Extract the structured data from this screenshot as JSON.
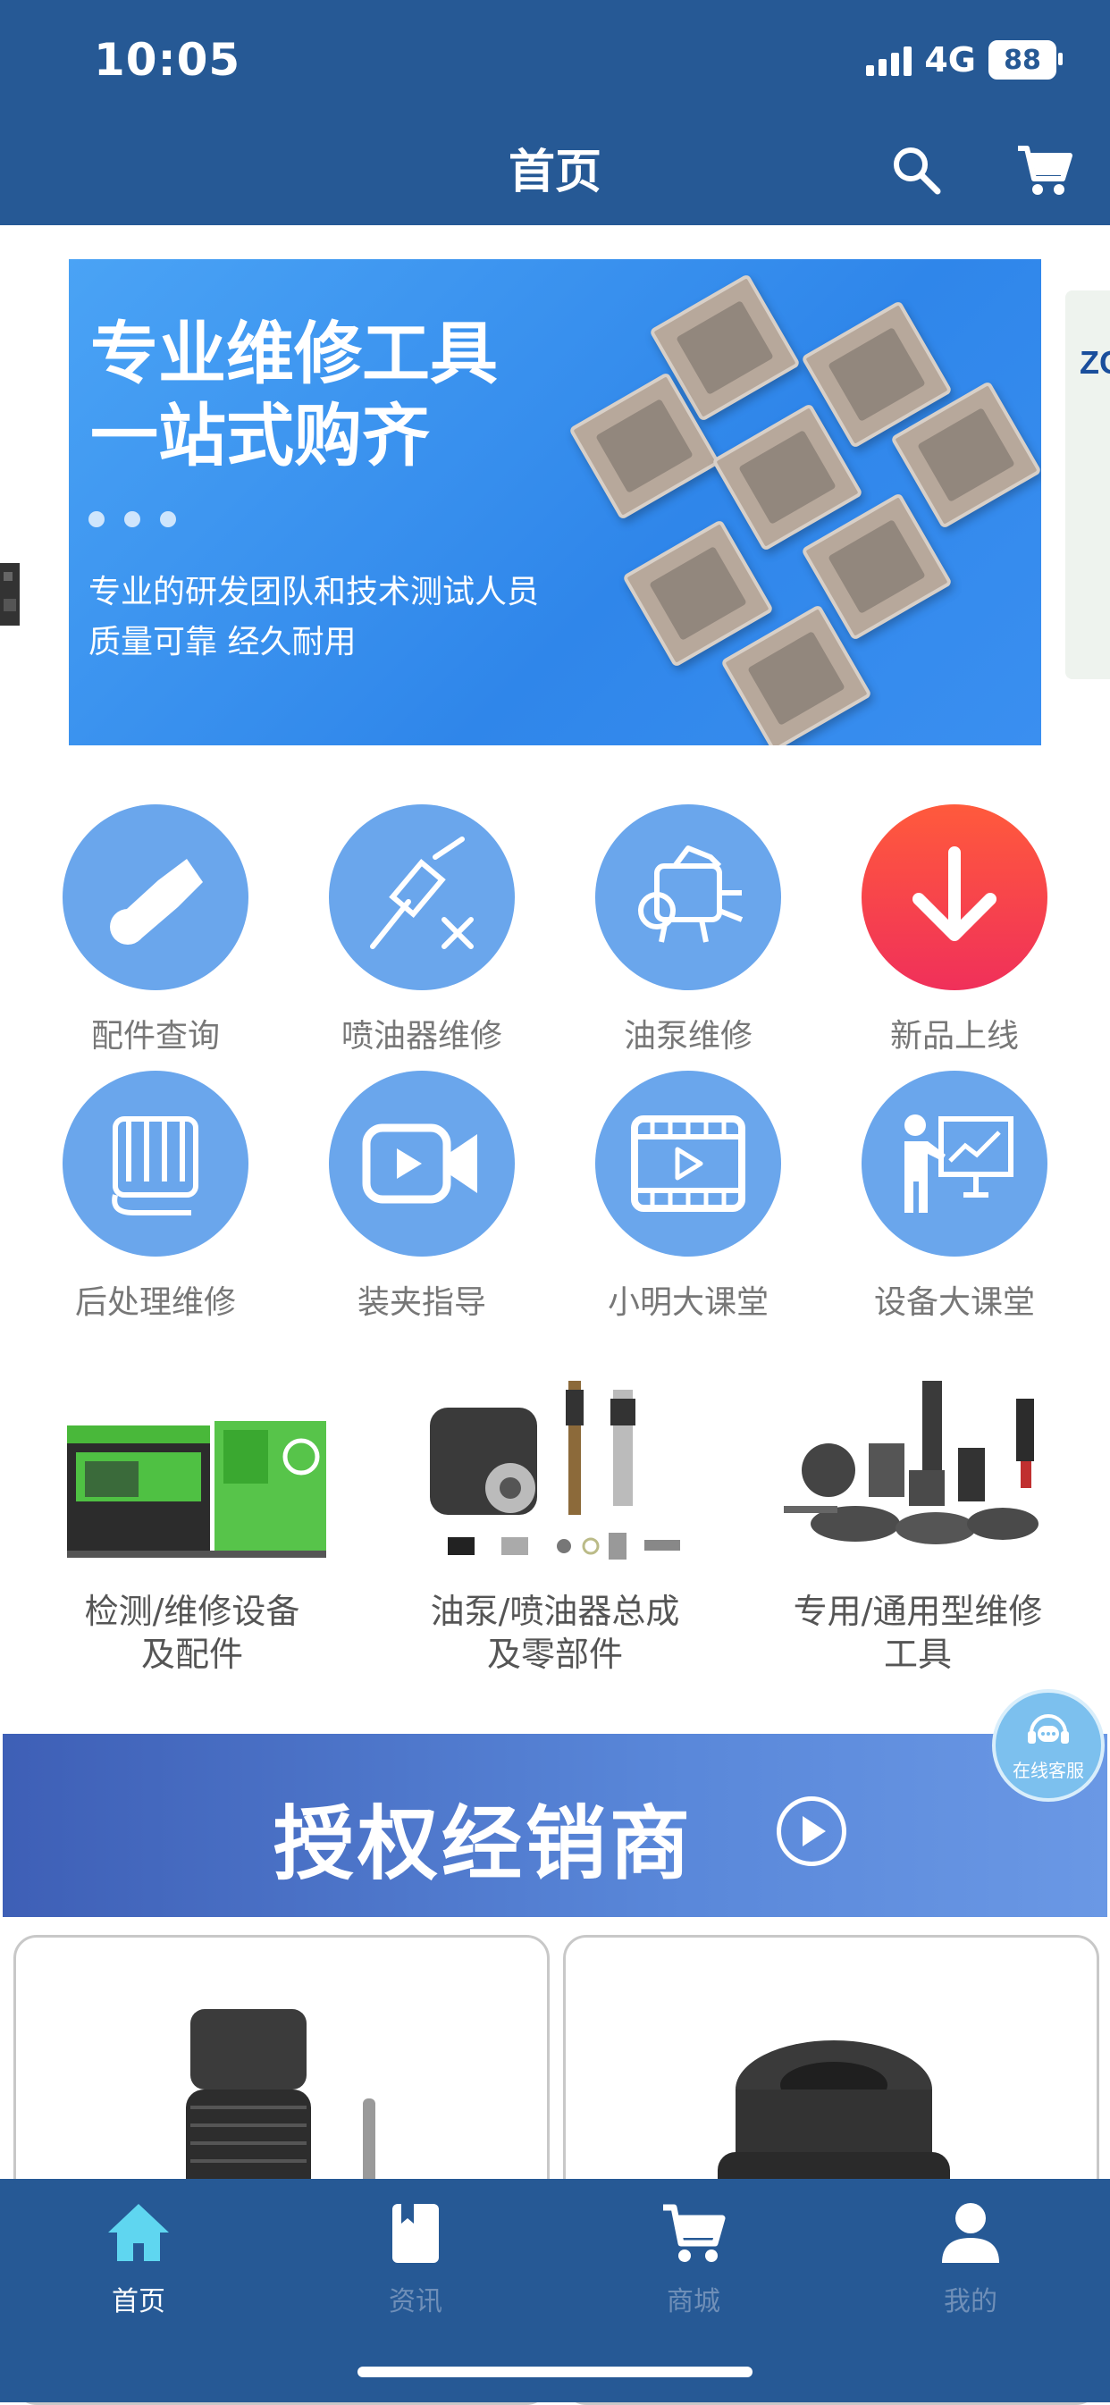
{
  "status_bar": {
    "time": "10:05",
    "network": "4G",
    "battery": "88"
  },
  "nav": {
    "title": "首页",
    "search_icon": "search-icon",
    "cart_icon": "cart-icon"
  },
  "banner": {
    "title": "专业维修工具\n一站式购齐",
    "subtitle": "专业的研发团队和技术测试人员\n质量可靠  经久耐用",
    "next_slide_peek": "ZO",
    "accent_color": "#2f86ea"
  },
  "grid": [
    {
      "label": "配件查询",
      "icon": "part-search-icon"
    },
    {
      "label": "喷油器维修",
      "icon": "injector-repair-icon"
    },
    {
      "label": "油泵维修",
      "icon": "pump-repair-icon"
    },
    {
      "label": "新品上线",
      "icon": "new-arrival-icon"
    },
    {
      "label": "后处理维修",
      "icon": "aftertreatment-icon"
    },
    {
      "label": "装夹指导",
      "icon": "video-camera-icon"
    },
    {
      "label": "小明大课堂",
      "icon": "video-play-icon"
    },
    {
      "label": "设备大课堂",
      "icon": "teacher-board-icon"
    }
  ],
  "categories": [
    {
      "label": "检测/维修设备\n及配件"
    },
    {
      "label": "油泵/喷油器总成\n及零部件"
    },
    {
      "label": "专用/通用型维修\n工具"
    }
  ],
  "dealer": {
    "text": "授权经销商"
  },
  "service": {
    "label": "在线客服"
  },
  "tabbar": [
    {
      "label": "首页",
      "icon": "home-icon",
      "active": true
    },
    {
      "label": "资讯",
      "icon": "news-icon",
      "active": false
    },
    {
      "label": "商城",
      "icon": "cart-icon",
      "active": false
    },
    {
      "label": "我的",
      "icon": "user-icon",
      "active": false
    }
  ],
  "colors": {
    "primary": "#265995",
    "active_tab": "#5fd6f0",
    "icon_circle": "#6aa6ec"
  }
}
